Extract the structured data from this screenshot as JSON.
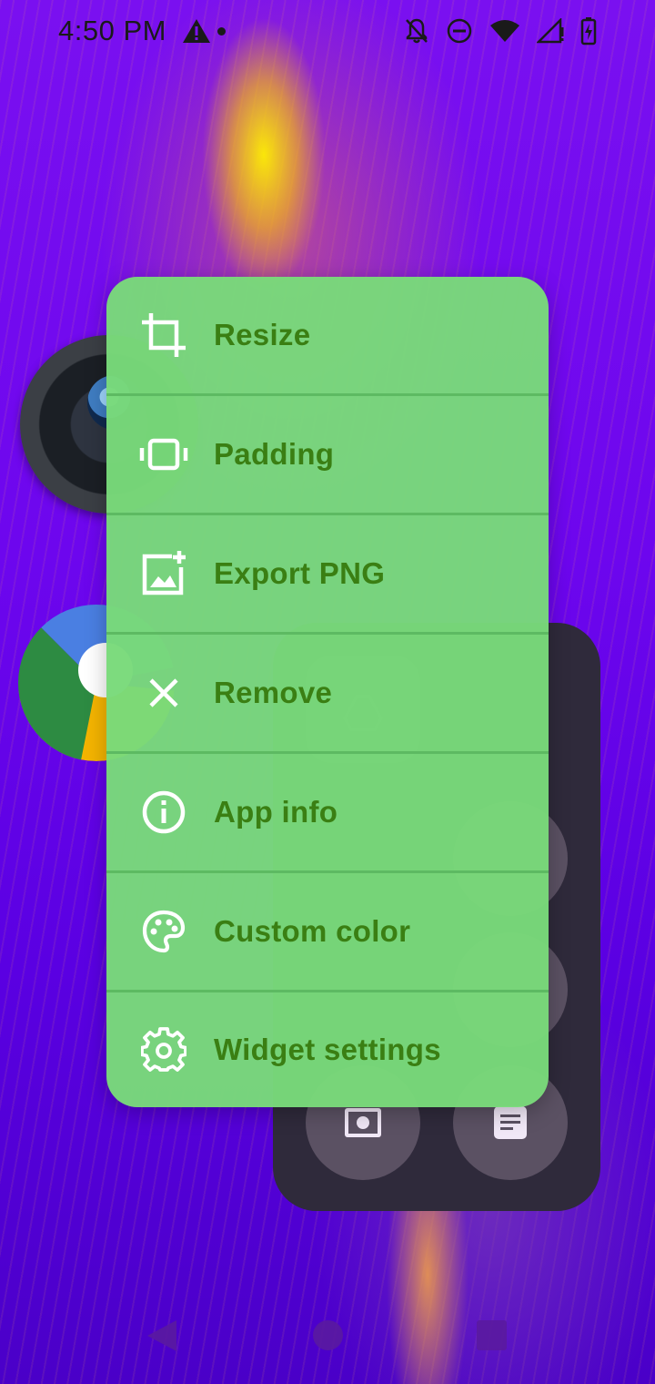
{
  "status_bar": {
    "time": "4:50 PM"
  },
  "menu": {
    "items": [
      {
        "label": "Resize",
        "icon": "crop-icon"
      },
      {
        "label": "Padding",
        "icon": "padding-icon"
      },
      {
        "label": "Export PNG",
        "icon": "add-photo-icon"
      },
      {
        "label": "Remove",
        "icon": "close-icon"
      },
      {
        "label": "App info",
        "icon": "info-icon"
      },
      {
        "label": "Custom color",
        "icon": "palette-icon"
      },
      {
        "label": "Widget settings",
        "icon": "gear-icon"
      }
    ]
  },
  "colors": {
    "menu_background": "#79DA7A",
    "menu_text": "#3A7F13",
    "wallpaper_primary": "#6A00E6",
    "wallpaper_accent": "#FFEE00",
    "widget_background": "#2F2A3B"
  }
}
